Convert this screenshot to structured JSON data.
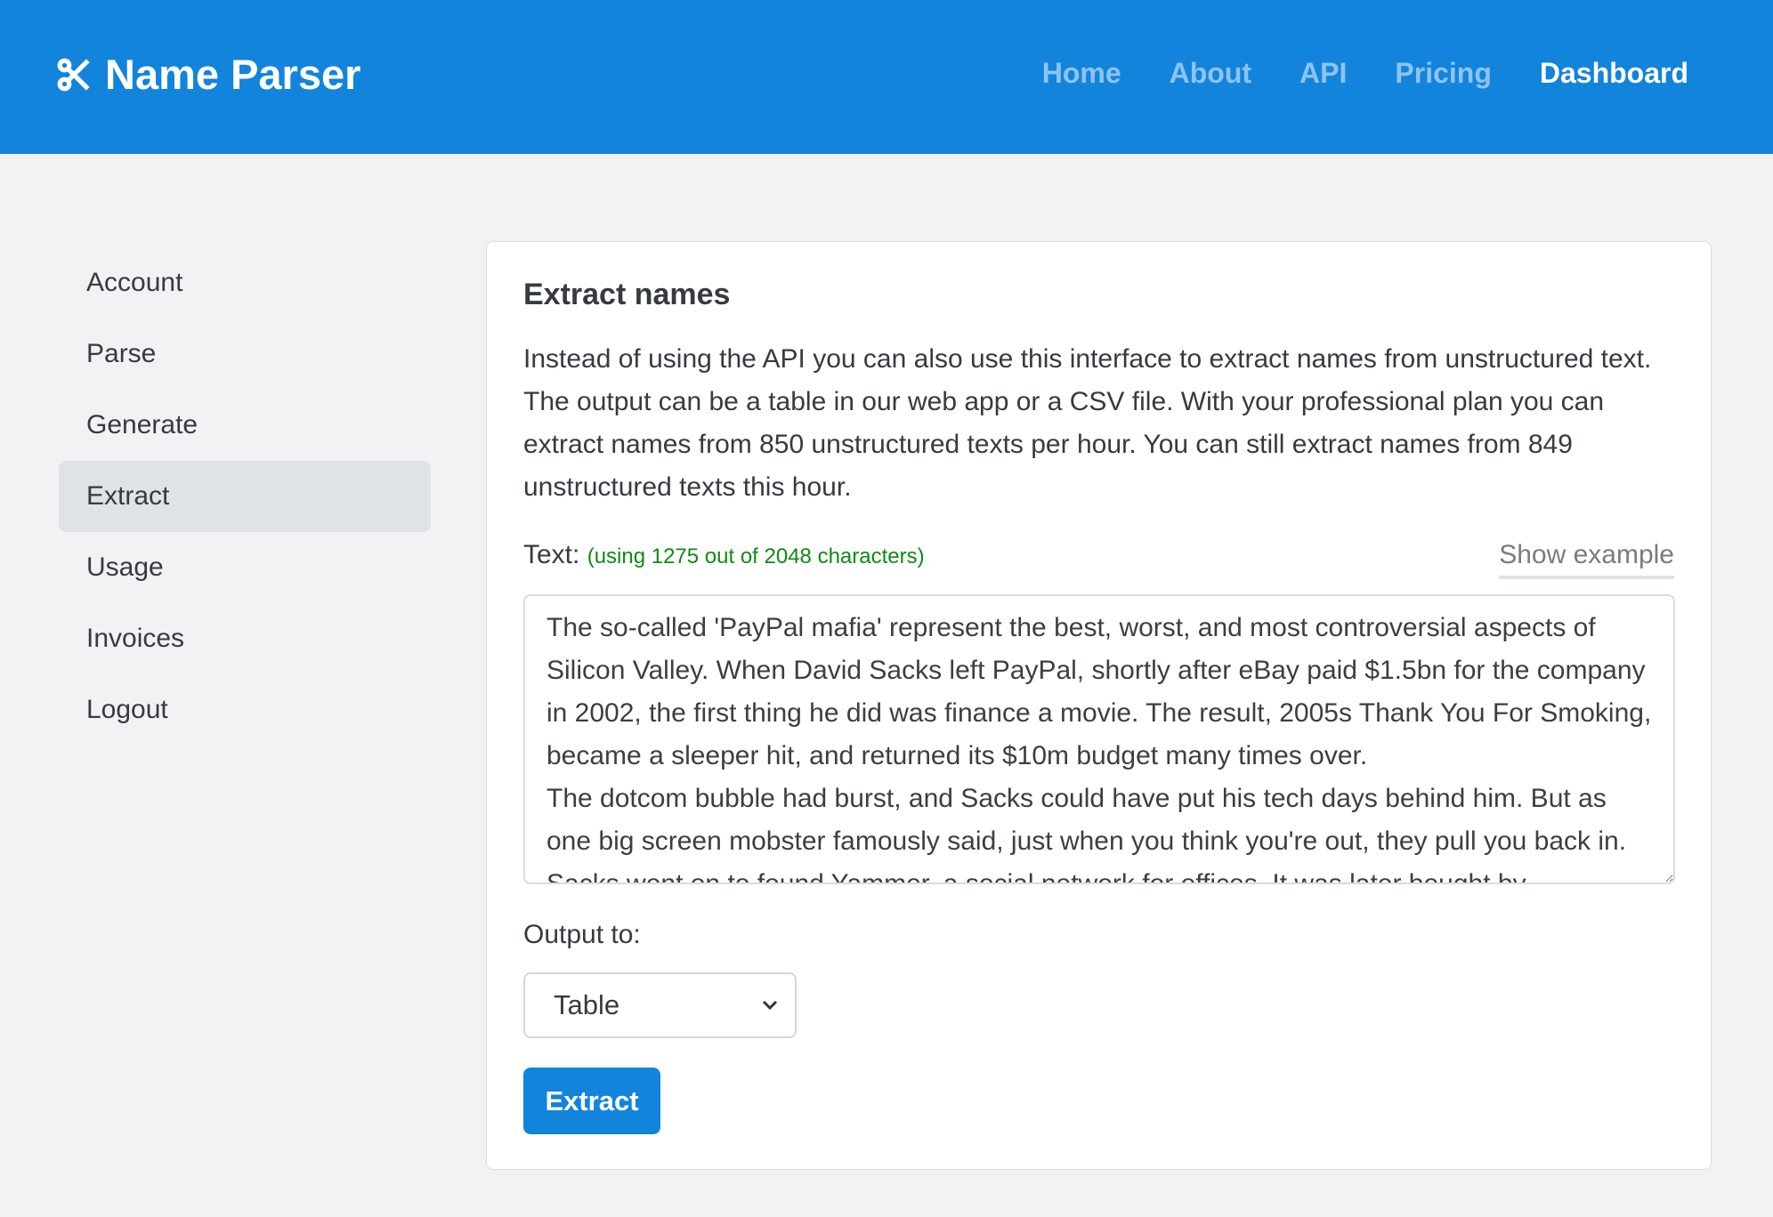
{
  "header": {
    "brand": "Name Parser",
    "logo_icon": "scissors-icon",
    "nav": [
      {
        "label": "Home"
      },
      {
        "label": "About"
      },
      {
        "label": "API"
      },
      {
        "label": "Pricing"
      },
      {
        "label": "Dashboard",
        "active": true
      }
    ]
  },
  "sidebar": {
    "items": [
      {
        "label": "Account"
      },
      {
        "label": "Parse"
      },
      {
        "label": "Generate"
      },
      {
        "label": "Extract",
        "active": true
      },
      {
        "label": "Usage"
      },
      {
        "label": "Invoices"
      },
      {
        "label": "Logout"
      }
    ]
  },
  "main": {
    "title": "Extract names",
    "description": "Instead of using the API you can also use this interface to extract names from unstructured text. The output can be a table in our web app or a CSV file. With your professional plan you can extract names from 850 unstructured texts per hour. You can still extract names from 849 unstructured texts this hour.",
    "text_label": "Text:",
    "text_hint": "(using 1275 out of 2048 characters)",
    "show_example": "Show example",
    "text_value": "The so-called 'PayPal mafia' represent the best, worst, and most controversial aspects of Silicon Valley. When David Sacks left PayPal, shortly after eBay paid $1.5bn for the company in 2002, the first thing he did was finance a movie. The result, 2005s Thank You For Smoking, became a sleeper hit, and returned its $10m budget many times over.\nThe dotcom bubble had burst, and Sacks could have put his tech days behind him. But as one big screen mobster famously said, just when you think you're out, they pull you back in. Sacks went on to found Yammer, a social network for offices. It was later bought by",
    "output_label": "Output to:",
    "output_value": "Table",
    "extract_button": "Extract",
    "colors": {
      "primary": "#1284dc",
      "hint": "#108a12"
    }
  }
}
